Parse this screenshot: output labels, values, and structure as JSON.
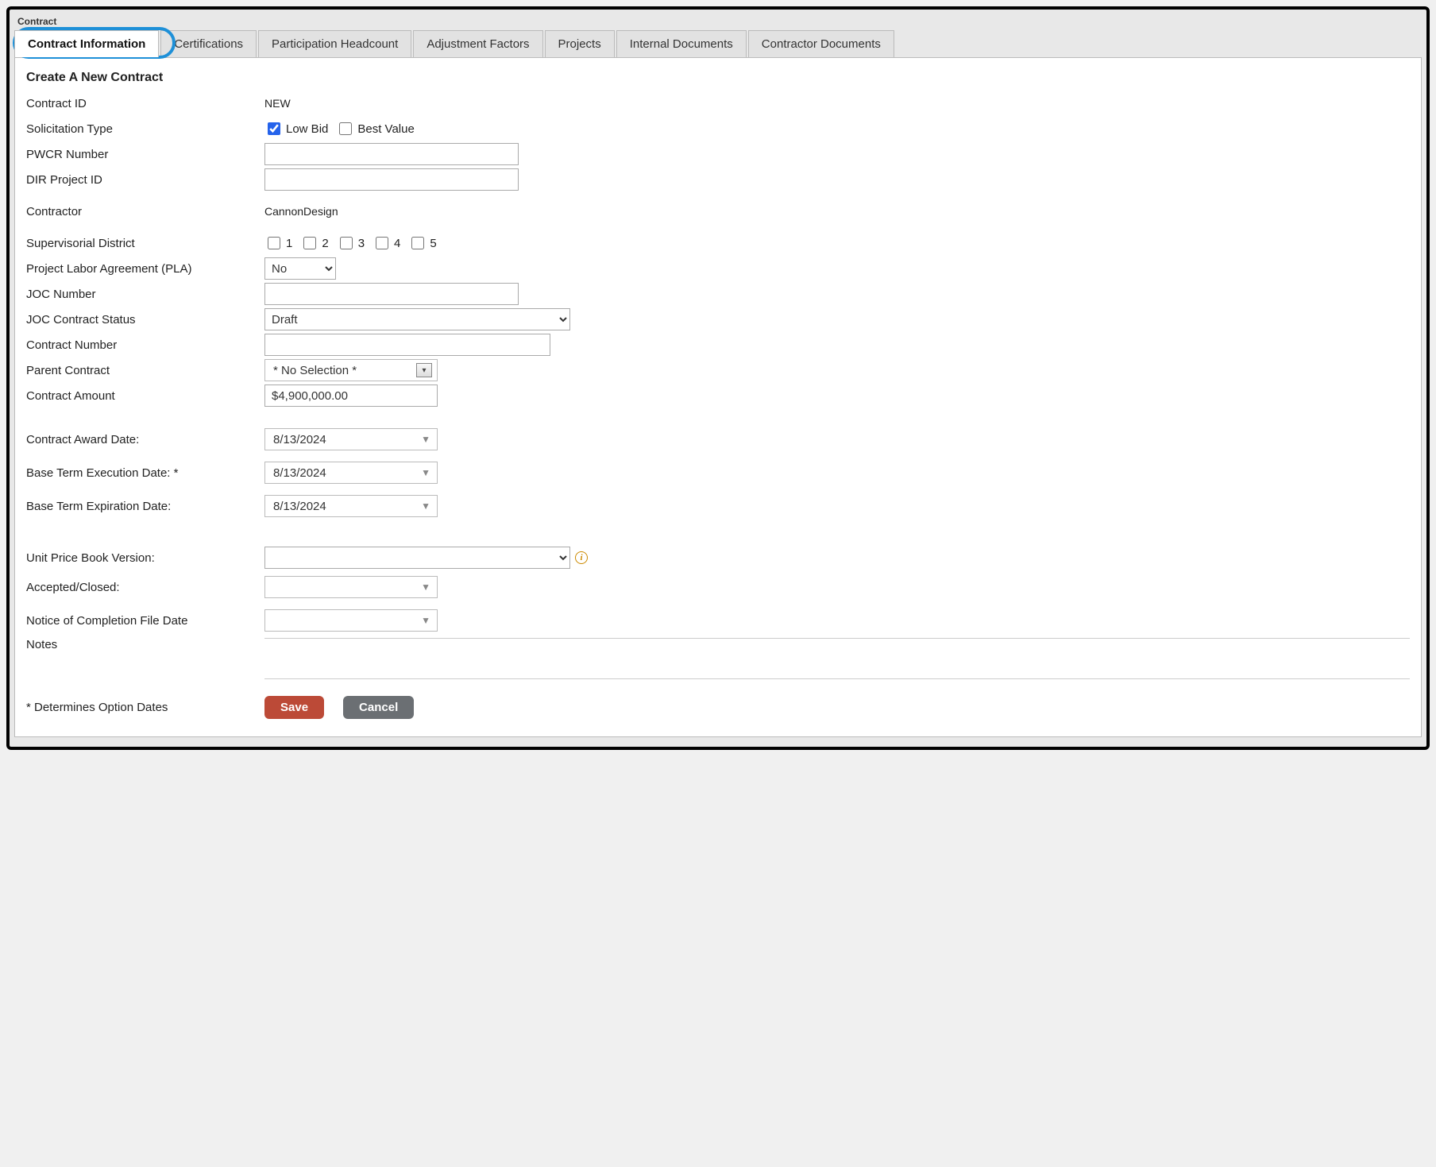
{
  "panel_title": "Contract",
  "tabs": [
    "Contract Information",
    "Certifications",
    "Participation Headcount",
    "Adjustment Factors",
    "Projects",
    "Internal Documents",
    "Contractor Documents"
  ],
  "heading": "Create A New Contract",
  "labels": {
    "contract_id": "Contract ID",
    "solicitation_type": "Solicitation Type",
    "pwcr_number": "PWCR Number",
    "dir_project_id": "DIR Project ID",
    "contractor": "Contractor",
    "supervisorial_district": "Supervisorial District",
    "pla": "Project Labor Agreement (PLA)",
    "joc_number": "JOC Number",
    "joc_status": "JOC Contract Status",
    "contract_number": "Contract Number",
    "parent_contract": "Parent Contract",
    "contract_amount": "Contract Amount",
    "contract_award_date": "Contract Award Date:",
    "base_exec_date": "Base Term Execution Date: *",
    "base_exp_date": "Base Term Expiration Date:",
    "upb_version": "Unit Price Book Version:",
    "accepted_closed": "Accepted/Closed:",
    "noc_file_date": "Notice of Completion File Date",
    "notes": "Notes",
    "determines": "* Determines Option Dates"
  },
  "values": {
    "contract_id": "NEW",
    "low_bid_label": "Low Bid",
    "best_value_label": "Best Value",
    "low_bid_checked": true,
    "best_value_checked": false,
    "pwcr_number": "",
    "dir_project_id": "",
    "contractor": "CannonDesign",
    "district_options": [
      "1",
      "2",
      "3",
      "4",
      "5"
    ],
    "pla": "No",
    "joc_number": "",
    "joc_status": "Draft",
    "contract_number": "",
    "parent_contract": "* No Selection *",
    "contract_amount": "$4,900,000.00",
    "contract_award_date": "8/13/2024",
    "base_exec_date": "8/13/2024",
    "base_exp_date": "8/13/2024",
    "upb_version": "",
    "accepted_closed": "",
    "noc_file_date": "",
    "notes": ""
  },
  "buttons": {
    "save": "Save",
    "cancel": "Cancel"
  }
}
